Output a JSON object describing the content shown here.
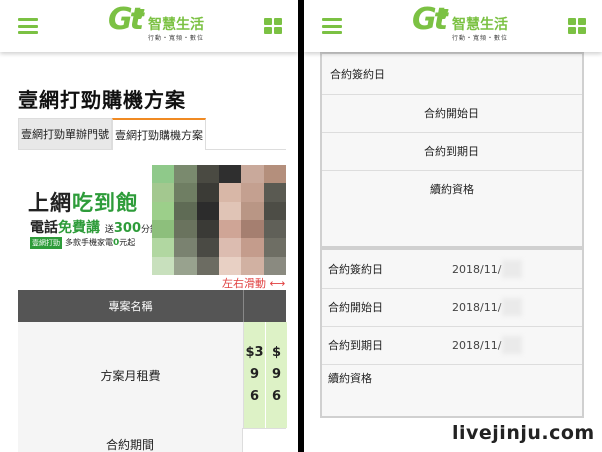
{
  "header": {
    "logo_text": "Gt",
    "logo_name": "智慧生活",
    "logo_slogan": "行動・寬頻・數位"
  },
  "left": {
    "page_title": "壹網打勁購機方案",
    "tabs": [
      {
        "label": "壹網打勁單辦門號"
      },
      {
        "label": "壹網打勁購機方案",
        "active": true
      }
    ],
    "banner": {
      "line1_plain": "上網",
      "line1_accent": "吃到飽",
      "line2_plain": "電話",
      "line2_accent": "免費講",
      "line2_prefix": "送",
      "line2_amount": "300",
      "line2_unit": "分鐘",
      "badge": "壹網打勁",
      "line3_plain": "多款手機家電",
      "line3_accent": "0",
      "line3_unit": "元起"
    },
    "scroll_hint": "左右滑動 ⟷",
    "table": {
      "header_label": "專案名稱",
      "header_next": "【",
      "rows": [
        {
          "label": "方案月租費",
          "values": [
            [
              "$3",
              "9",
              "6"
            ],
            [
              "$",
              "9",
              "6"
            ]
          ]
        },
        {
          "label": "合約期間"
        }
      ]
    }
  },
  "right": {
    "top_rows": [
      {
        "label": "合約簽約日"
      },
      {
        "label": "合約開始日"
      },
      {
        "label": "合約到期日"
      },
      {
        "label": "續約資格"
      }
    ],
    "bottom_rows": [
      {
        "label": "合約簽約日",
        "value": "2018/11/"
      },
      {
        "label": "合約開始日",
        "value": "2018/11/"
      },
      {
        "label": "合約到期日",
        "value": "2018/11/"
      },
      {
        "label": "續約資格",
        "value": ""
      }
    ]
  },
  "watermark": "livejinju.com",
  "colors": {
    "brand_green": "#7bc143",
    "accent_green": "#2e9c3a",
    "tab_orange": "#f08a23",
    "table_header": "#555555",
    "value_cell": "#ddf2c6",
    "hint_red": "#e04040"
  },
  "icons": {
    "menu": "hamburger-icon",
    "apps": "grid-icon"
  }
}
